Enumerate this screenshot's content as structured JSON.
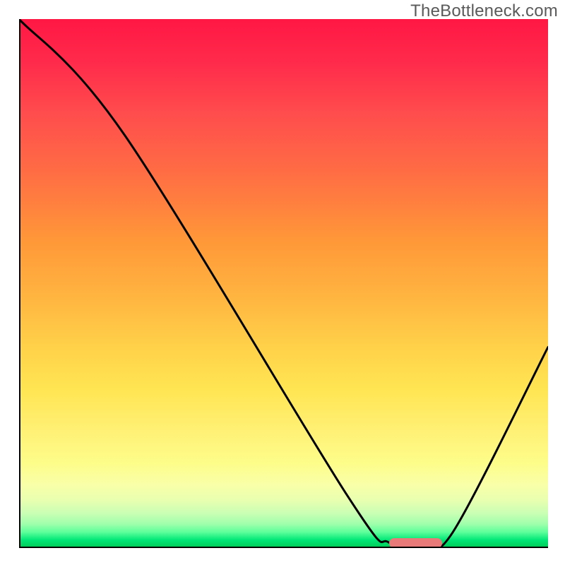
{
  "watermark": "TheBottleneck.com",
  "chart_data": {
    "type": "line",
    "title": "",
    "xlabel": "",
    "ylabel": "",
    "xlim": [
      0,
      100
    ],
    "ylim": [
      0,
      100
    ],
    "series": [
      {
        "name": "bottleneck-curve",
        "x": [
          0,
          20,
          62,
          70,
          76,
          82,
          100
        ],
        "y": [
          100,
          78,
          10,
          1,
          1,
          3,
          38
        ]
      }
    ],
    "marker": {
      "x_start": 70,
      "x_end": 80,
      "y": 1,
      "color": "#e87a7a"
    },
    "background_gradient": {
      "stops": [
        {
          "pos": 0,
          "color": "#ff1744"
        },
        {
          "pos": 50,
          "color": "#ffd149"
        },
        {
          "pos": 85,
          "color": "#fdfd8a"
        },
        {
          "pos": 100,
          "color": "#00c853"
        }
      ]
    }
  }
}
